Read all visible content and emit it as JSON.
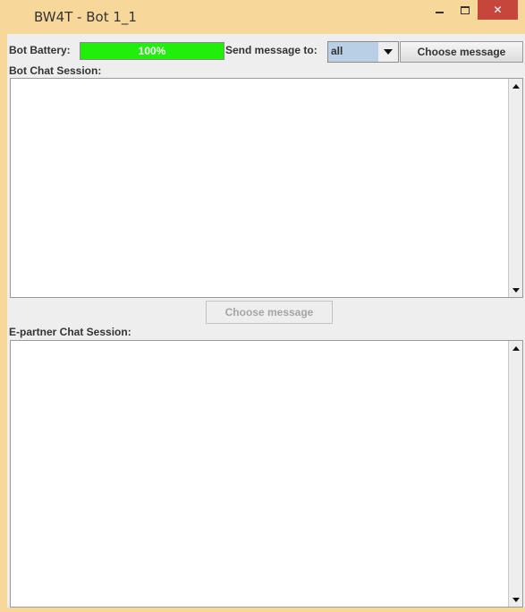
{
  "window": {
    "title": "BW4T - Bot 1_1",
    "close_glyph": "✕",
    "frame_color": "#f8d89a",
    "close_color": "#c7463c"
  },
  "toolbar": {
    "battery_label": "Bot Battery:",
    "battery_value": "100%",
    "battery_percent": 100,
    "battery_color": "#22ee0c",
    "send_label": "Send message to:",
    "recipient_selected": "all",
    "choose_message_button": "Choose message"
  },
  "bot_chat": {
    "label": "Bot Chat Session:",
    "choose_message_button": "Choose message",
    "choose_message_enabled": false
  },
  "epartner_chat": {
    "label": "E-partner Chat Session:"
  },
  "icons": {
    "minimize": "minimize-icon",
    "maximize": "maximize-icon",
    "close": "close-icon",
    "dropdown": "chevron-down-icon",
    "scroll_up": "scroll-up-icon",
    "scroll_down": "scroll-down-icon"
  }
}
